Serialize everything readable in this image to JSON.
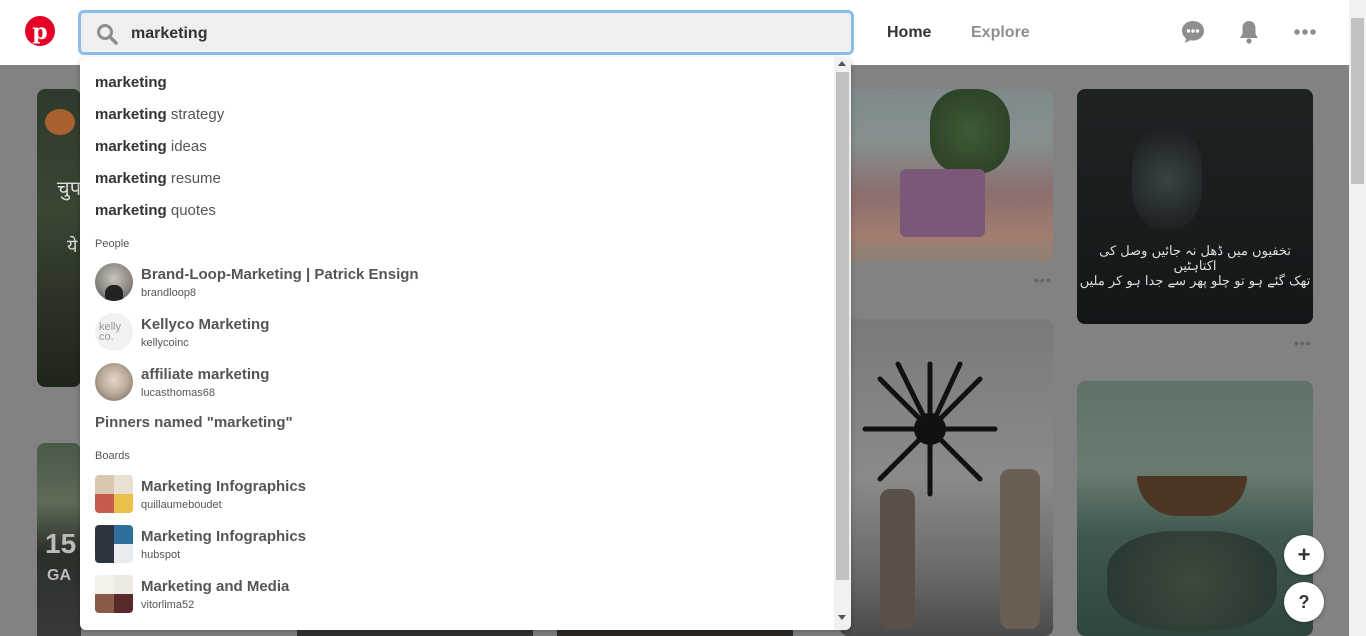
{
  "header": {
    "logo_letter": "p",
    "search_value": "marketing",
    "nav_home": "Home",
    "nav_explore": "Explore"
  },
  "dropdown": {
    "suggestions": [
      {
        "bold": "marketing",
        "rest": ""
      },
      {
        "bold": "marketing",
        "rest": " strategy"
      },
      {
        "bold": "marketing",
        "rest": " ideas"
      },
      {
        "bold": "marketing",
        "rest": " resume"
      },
      {
        "bold": "marketing",
        "rest": " quotes"
      }
    ],
    "people_label": "People",
    "people": [
      {
        "name": "Brand-Loop-Marketing | Patrick Ensign",
        "username": "brandloop8"
      },
      {
        "name": "Kellyco Marketing",
        "username": "kellycoinc",
        "avatar_text": "kelly co."
      },
      {
        "name": "affiliate marketing",
        "username": "lucasthomas68"
      }
    ],
    "pinners_named": "Pinners named \"marketing\"",
    "boards_label": "Boards",
    "boards": [
      {
        "name": "Marketing Infographics",
        "username": "quillaumeboudet"
      },
      {
        "name": "Marketing Infographics",
        "username": "hubspot"
      },
      {
        "name": "Marketing and Media",
        "username": "vitorlima52"
      }
    ]
  },
  "pins": {
    "urdu_line1": "تخفیوں میں ڈھل نہ جائیں وصل کی اکتاہٹیں",
    "urdu_line2": "تھک گئے ہو تو چلو پھر سے جدا ہو کر ملیں",
    "pin_more": "•••",
    "left_text1": "चुप",
    "left_text2": "ये",
    "left_big_number": "15",
    "left_big_text": "GA"
  },
  "fab": {
    "add": "+",
    "help": "?"
  }
}
